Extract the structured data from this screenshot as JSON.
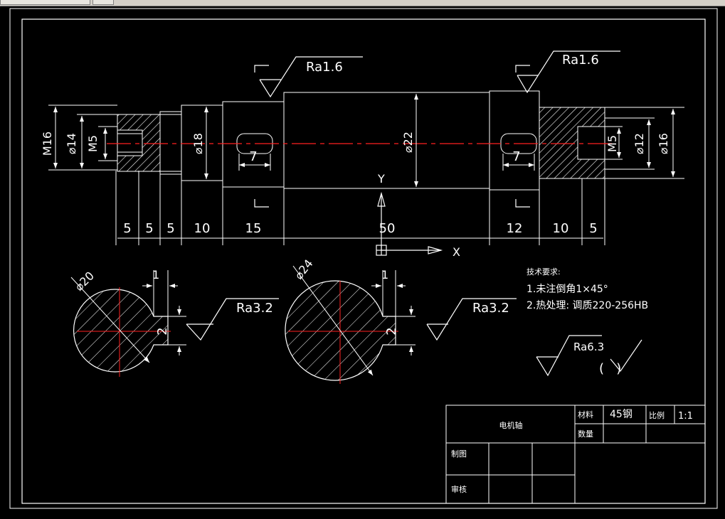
{
  "drawing": {
    "dimensions_horizontal": [
      "5",
      "5",
      "5",
      "10",
      "15",
      "50",
      "12",
      "10",
      "5"
    ],
    "dia_m16": "M16",
    "dia_14": "⌀14",
    "dia_m5_left": "M5",
    "dia_18": "⌀18",
    "dia_22": "⌀22",
    "dia_m5_right": "M5",
    "dia_12": "⌀12",
    "dia_16": "⌀16",
    "keyway_left": "7",
    "keyway_right": "7",
    "roughness_top_left": "Ra1.6",
    "roughness_top_right": "Ra1.6",
    "axis_y": "Y",
    "axis_x": "X",
    "section1_dia": "⌀20",
    "section1_depth": "1",
    "section1_width": "2",
    "section1_roughness": "Ra3.2",
    "section2_dia": "⌀24",
    "section2_depth": "1",
    "section2_width": "2",
    "section2_roughness": "Ra3.2",
    "general_roughness": "Ra6.3",
    "general_roughness_paren": "(   )"
  },
  "notes": {
    "title": "技术要求:",
    "line1": "1.未注倒角1×45°",
    "line2": "2.热处理: 调质220-256HB"
  },
  "title_block": {
    "part_name": "电机轴",
    "material_label": "材料",
    "material_value": "45钢",
    "scale_label": "比例",
    "scale_value": "1:1",
    "quantity_label": "数量",
    "drawn_label": "制图",
    "checked_label": "审核"
  },
  "colors": {
    "background": "#000000",
    "lines": "#ffffff",
    "centerline": "#ff2020"
  }
}
